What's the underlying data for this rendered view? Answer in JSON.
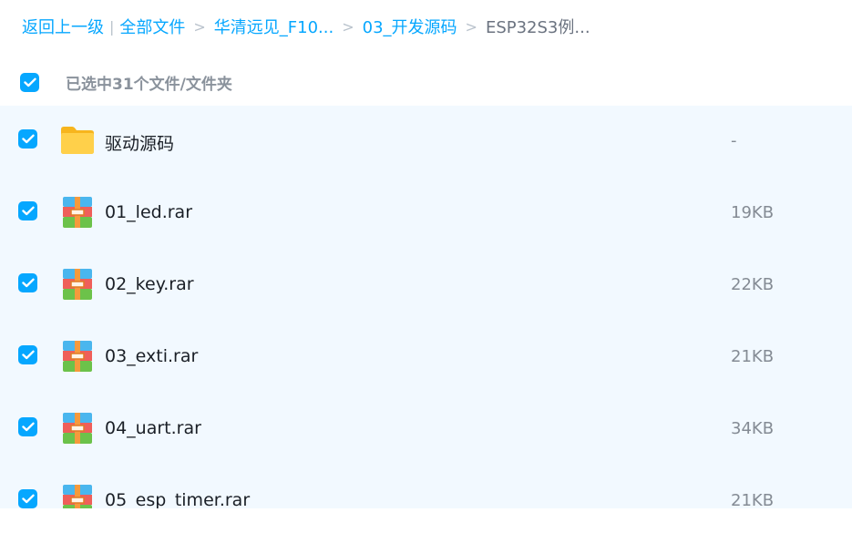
{
  "breadcrumb": {
    "back": "返回上一级",
    "sep_bar": "|",
    "all_files": "全部文件",
    "sep": ">",
    "level1": "华清远见_F10...",
    "level2": "03_开发源码",
    "current": "ESP32S3例..."
  },
  "selection": {
    "label": "已选中31个文件/文件夹"
  },
  "files": [
    {
      "name": "驱动源码",
      "size": "-",
      "type": "folder-icon"
    },
    {
      "name": "01_led.rar",
      "size": "19KB",
      "type": "rar-icon"
    },
    {
      "name": "02_key.rar",
      "size": "22KB",
      "type": "rar-icon"
    },
    {
      "name": "03_exti.rar",
      "size": "21KB",
      "type": "rar-icon"
    },
    {
      "name": "04_uart.rar",
      "size": "34KB",
      "type": "rar-icon"
    },
    {
      "name": "05_esp_timer.rar",
      "size": "21KB",
      "type": "rar-icon"
    }
  ],
  "colors": {
    "accent": "#06a7ff",
    "list_background": "#f2f9ff"
  }
}
